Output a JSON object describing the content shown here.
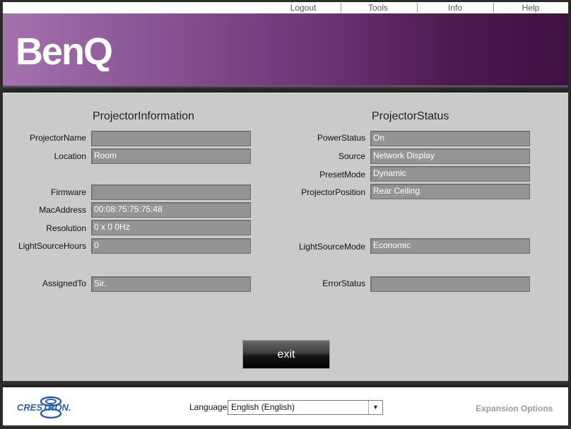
{
  "nav": {
    "logout": "Logout",
    "tools": "Tools",
    "info": "Info",
    "help": "Help"
  },
  "brand": {
    "logo_text": "BenQ",
    "color": "#ffffff"
  },
  "projector_info": {
    "title": "ProjectorInformation",
    "rows": [
      {
        "label": "ProjectorName",
        "value": ""
      },
      {
        "label": "Location",
        "value": "Room"
      },
      {
        "label": "Firmware",
        "value": ""
      },
      {
        "label": "MacAddress",
        "value": "00:08:75:75:75:48"
      },
      {
        "label": "Resolution",
        "value": "0 x 0 0Hz"
      },
      {
        "label": "LightSourceHours",
        "value": "0"
      },
      {
        "label": "AssignedTo",
        "value": "Sir."
      }
    ]
  },
  "projector_status": {
    "title": "ProjectorStatus",
    "rows": [
      {
        "label": "PowerStatus",
        "value": "On"
      },
      {
        "label": "Source",
        "value": "Network Display"
      },
      {
        "label": "PresetMode",
        "value": "Dynamic"
      },
      {
        "label": "ProjectorPosition",
        "value": "Rear Ceiling"
      },
      {
        "label": "LightSourceMode",
        "value": "Economic"
      },
      {
        "label": "ErrorStatus",
        "value": ""
      }
    ]
  },
  "exit_label": "exit",
  "footer": {
    "crestron_logo": "CRESTRON.",
    "language_label": "Language",
    "language_value": "English (English)",
    "expansion_options": "Expansion Options"
  },
  "colors": {
    "banner_start": "#a473ad",
    "banner_end": "#3e1240",
    "panel_bg": "#cacaca",
    "field_bg": "#949494",
    "crestron_blue": "#2e5fa8"
  }
}
